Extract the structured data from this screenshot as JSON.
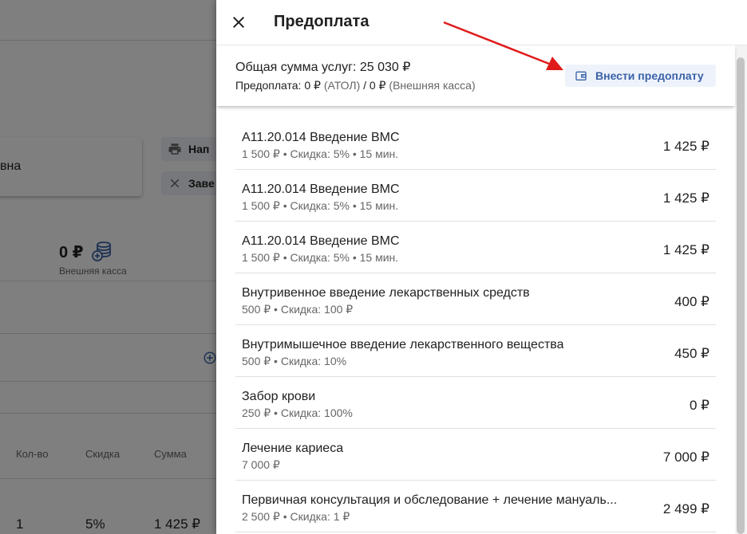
{
  "background": {
    "card_text": "вна",
    "print_button_label": "Нап",
    "close_button_label": "Заве",
    "external_amount": "0 ₽",
    "external_kassa_label": "Внешняя касса",
    "table_headers": [
      "Кол-во",
      "Скидка",
      "Сумма"
    ],
    "table_row": [
      "1",
      "5%",
      "1 425 ₽"
    ]
  },
  "drawer": {
    "title": "Предоплата",
    "summary_total": "Общая сумма услуг: 25 030 ₽",
    "prepay_label": "Предоплата: ",
    "prepay_atol_value": "0 ₽",
    "prepay_atol_label": "(АТОЛ)",
    "prepay_separator": " / ",
    "prepay_external_value": "0 ₽",
    "prepay_external_label": "(Внешняя касса)",
    "prepay_button_label": "Внести предоплату"
  },
  "services": [
    {
      "name": "A11.20.014 Введение ВМС",
      "meta": "1 500 ₽ • Скидка: 5% • 15 мин.",
      "price": "1 425 ₽"
    },
    {
      "name": "A11.20.014 Введение ВМС",
      "meta": "1 500 ₽ • Скидка: 5% • 15 мин.",
      "price": "1 425 ₽"
    },
    {
      "name": "A11.20.014 Введение ВМС",
      "meta": "1 500 ₽ • Скидка: 5% • 15 мин.",
      "price": "1 425 ₽"
    },
    {
      "name": "Внутривенное введение лекарственных средств",
      "meta": "500 ₽ • Скидка: 100 ₽",
      "price": "400 ₽"
    },
    {
      "name": "Внутримышечное введение лекарственного вещества",
      "meta": "500 ₽ • Скидка: 10%",
      "price": "450 ₽"
    },
    {
      "name": "Забор крови",
      "meta": "250 ₽ • Скидка: 100%",
      "price": "0 ₽"
    },
    {
      "name": "Лечение кариеса",
      "meta": "7 000 ₽",
      "price": "7 000 ₽"
    },
    {
      "name": "Первичная консультация и обследование + лечение мануаль...",
      "meta": "2 500 ₽ • Скидка: 1 ₽",
      "price": "2 499 ₽"
    }
  ],
  "colors": {
    "accent": "#3a62a8",
    "annotation_arrow": "#e01b1b"
  },
  "icons": {
    "close": "close-icon",
    "wallet": "wallet-icon",
    "printer": "printer-icon",
    "coins": "coins-icon",
    "add": "add-circle-icon"
  }
}
